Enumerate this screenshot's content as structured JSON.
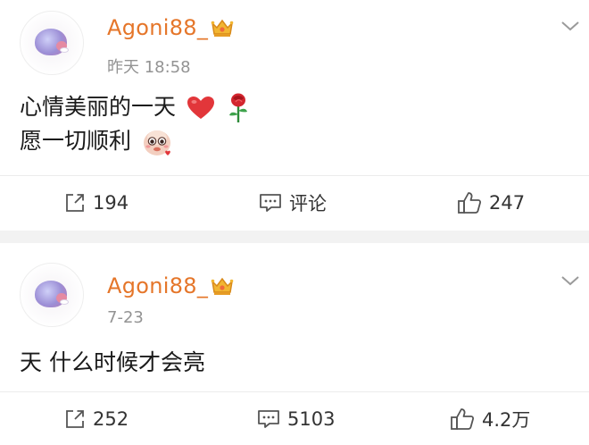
{
  "posts": [
    {
      "username": "Agoni88_",
      "timestamp": "昨天 18:58",
      "content_lines": [
        "心情美丽的一天",
        "愿一切顺利"
      ],
      "actions": {
        "repost": "194",
        "comment": "评论",
        "like": "247"
      }
    },
    {
      "username": "Agoni88_",
      "timestamp": "7-23",
      "content_lines": [
        "天 什么时候才会亮"
      ],
      "actions": {
        "repost": "252",
        "comment": "5103",
        "like": "4.2万"
      }
    }
  ],
  "icons": {
    "crown": "crown-icon",
    "chevron": "chevron-down-icon",
    "repost": "share-icon",
    "comment": "comment-icon",
    "like": "thumbs-up-icon",
    "heart": "heart-emoji",
    "rose": "rose-emoji",
    "sticker": "cute-sticker-emoji"
  },
  "colors": {
    "username": "#e5762a",
    "timestamp": "#939393",
    "heart": "#e2363a",
    "separator": "#f2f2f2"
  }
}
